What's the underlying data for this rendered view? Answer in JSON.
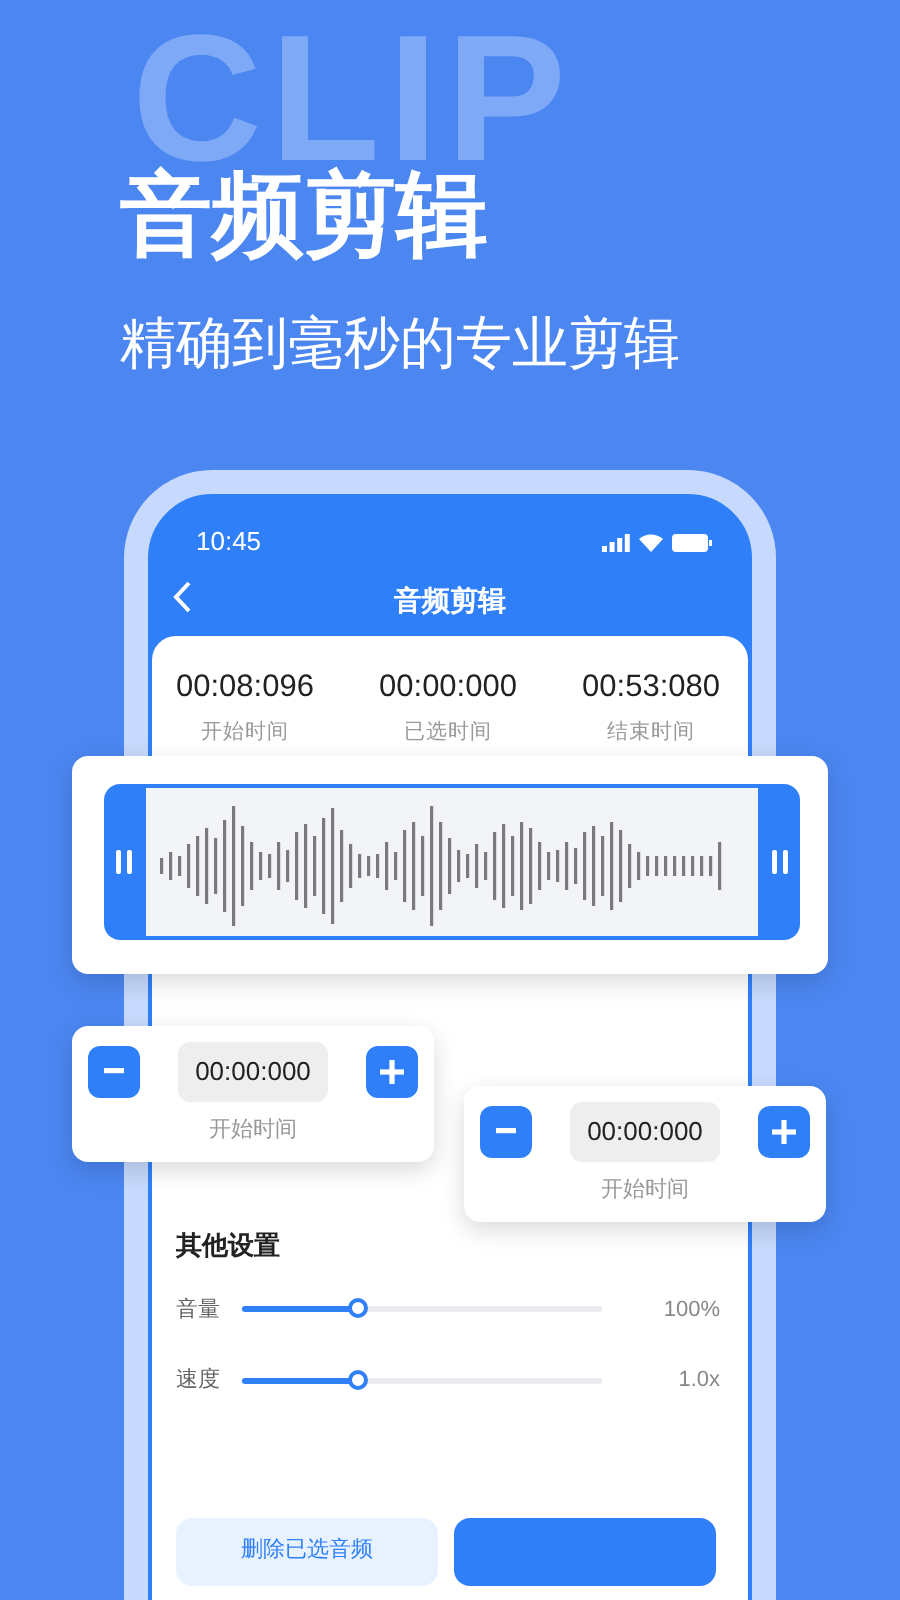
{
  "background_word": "CLIP",
  "title": "音频剪辑",
  "subtitle": "精确到毫秒的专业剪辑",
  "phone": {
    "status_time": "10:45",
    "nav_title": "音频剪辑",
    "times": [
      {
        "value": "00:08:096",
        "label": "开始时间"
      },
      {
        "value": "00:00:000",
        "label": "已选时间"
      },
      {
        "value": "00:53:080",
        "label": "结束时间"
      }
    ],
    "settings_title": "其他设置",
    "sliders": [
      {
        "label": "音量",
        "level": 0.32,
        "reading": "100%"
      },
      {
        "label": "速度",
        "level": 0.32,
        "reading": "1.0x"
      }
    ],
    "buttons": [
      {
        "kind": "secondary",
        "label": "删除已选音频"
      },
      {
        "kind": "primary"
      }
    ]
  },
  "steppers": [
    {
      "value": "00:00:000",
      "label": "开始时间"
    },
    {
      "value": "00:00:000",
      "label": "开始时间"
    }
  ]
}
